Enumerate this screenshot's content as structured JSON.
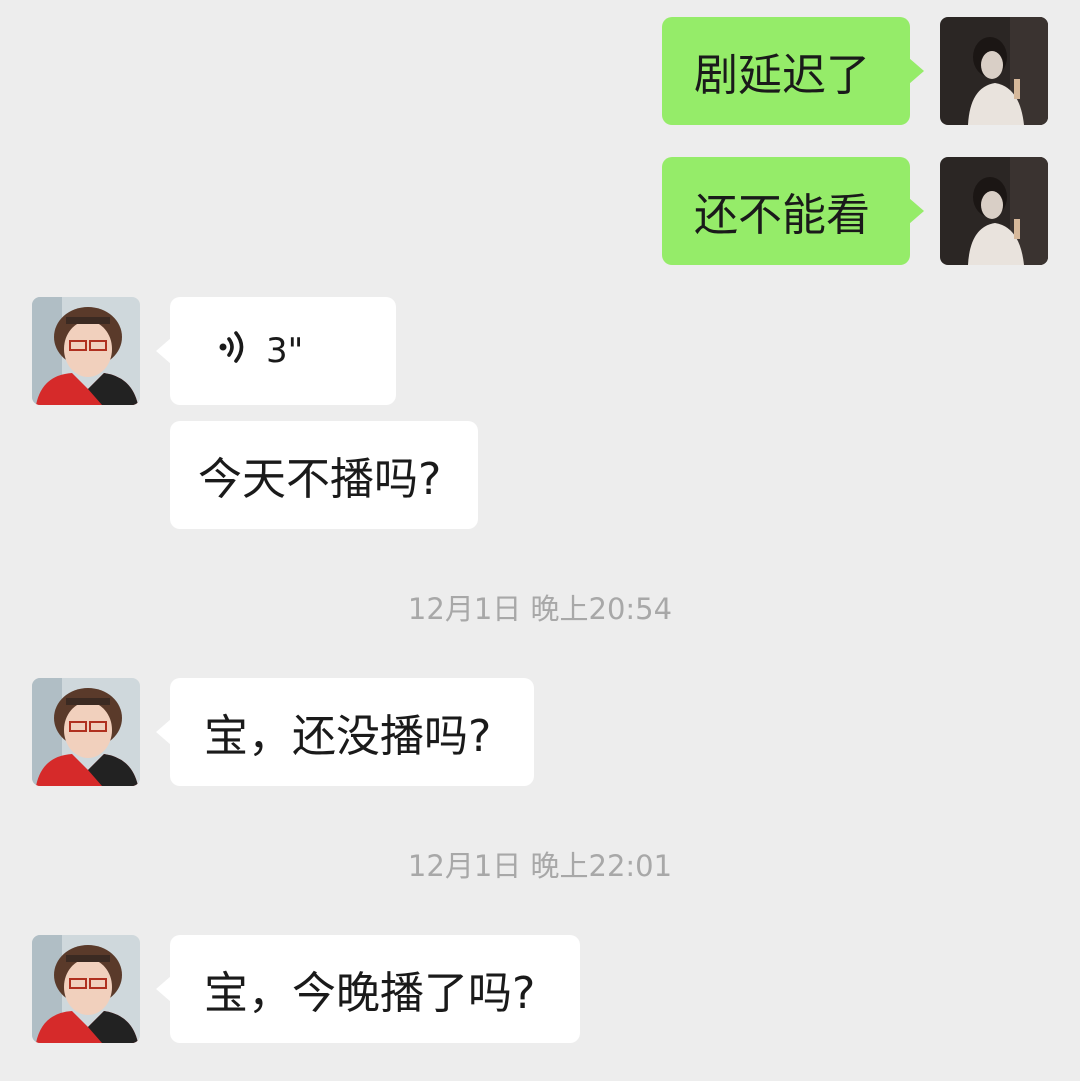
{
  "conversation": {
    "messages": [
      {
        "sender": "me",
        "type": "text",
        "text": "剧延迟了"
      },
      {
        "sender": "me",
        "type": "text",
        "text": "还不能看"
      },
      {
        "sender": "other",
        "type": "voice",
        "duration": "3\""
      },
      {
        "sender": "other",
        "type": "text",
        "text": "今天不播吗?"
      },
      {
        "type": "timestamp",
        "text": "12月1日 晚上20:54"
      },
      {
        "sender": "other",
        "type": "text",
        "text": "宝，还没播吗?"
      },
      {
        "type": "timestamp",
        "text": "12月1日 晚上22:01"
      },
      {
        "sender": "other",
        "type": "text",
        "text": "宝，今晚播了吗?"
      }
    ]
  },
  "icons": {
    "voice": "voice-wave-icon"
  },
  "colors": {
    "background": "#ededed",
    "my_bubble": "#95ec69",
    "other_bubble": "#ffffff",
    "timestamp": "#a8a8a8"
  }
}
